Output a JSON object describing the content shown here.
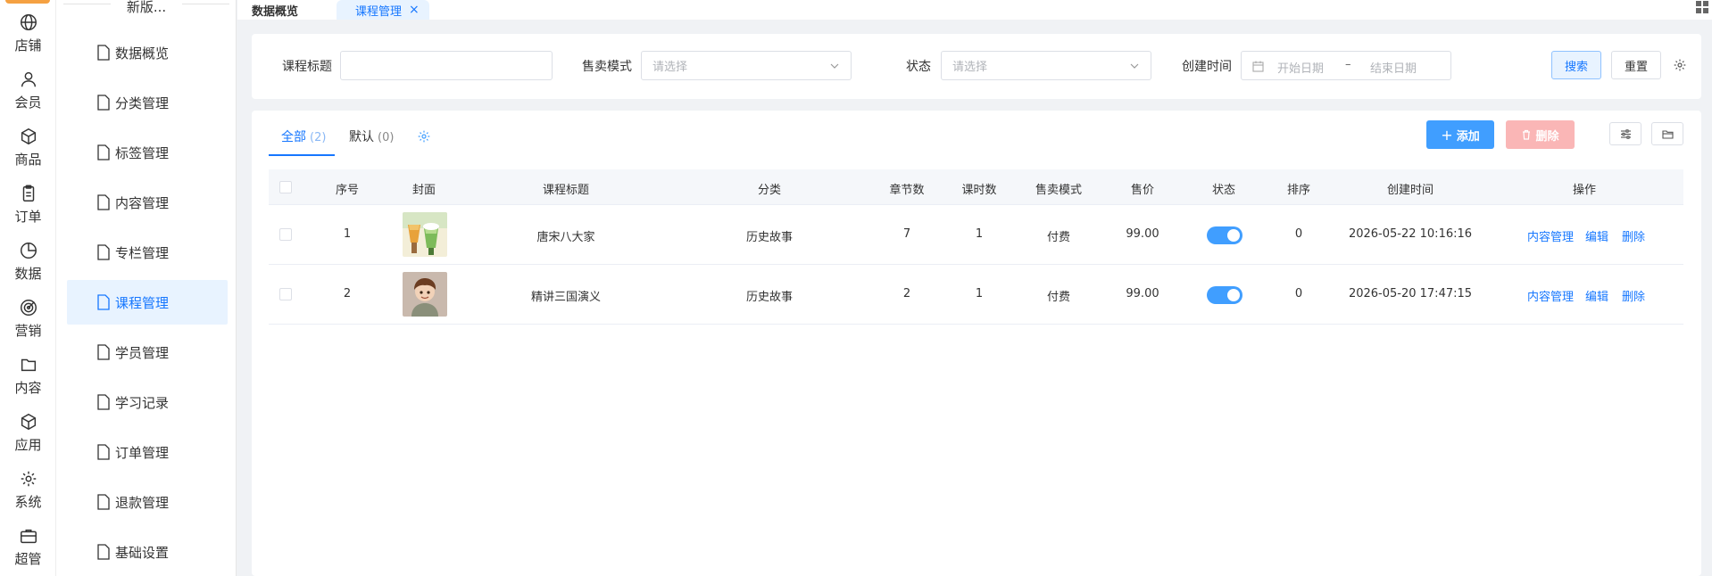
{
  "rail": {
    "items": [
      {
        "label": "店铺",
        "icon": "globe-icon"
      },
      {
        "label": "会员",
        "icon": "user-icon"
      },
      {
        "label": "商品",
        "icon": "box-icon"
      },
      {
        "label": "订单",
        "icon": "clipboard-icon"
      },
      {
        "label": "数据",
        "icon": "pie-chart-icon"
      },
      {
        "label": "营销",
        "icon": "target-icon"
      },
      {
        "label": "内容",
        "icon": "folder-icon"
      },
      {
        "label": "应用",
        "icon": "cube-icon"
      },
      {
        "label": "系统",
        "icon": "gear-icon"
      },
      {
        "label": "超管",
        "icon": "briefcase-icon"
      }
    ]
  },
  "submenu": {
    "title": "新版...",
    "items": [
      {
        "label": "数据概览"
      },
      {
        "label": "分类管理"
      },
      {
        "label": "标签管理"
      },
      {
        "label": "内容管理"
      },
      {
        "label": "专栏管理"
      },
      {
        "label": "课程管理",
        "active": true
      },
      {
        "label": "学员管理"
      },
      {
        "label": "学习记录"
      },
      {
        "label": "订单管理"
      },
      {
        "label": "退款管理"
      },
      {
        "label": "基础设置"
      }
    ]
  },
  "tabs": {
    "items": [
      {
        "label": "数据概览"
      },
      {
        "label": "课程管理",
        "close": "×"
      }
    ]
  },
  "search": {
    "title_label": "课程标题",
    "title_value": "",
    "mode_label": "售卖模式",
    "mode_placeholder": "请选择",
    "status_label": "状态",
    "status_placeholder": "请选择",
    "created_label": "创建时间",
    "start_placeholder": "开始日期",
    "range_sep": "–",
    "end_placeholder": "结束日期",
    "search_btn": "搜索",
    "reset_btn": "重置"
  },
  "list": {
    "tab_all": "全部",
    "tab_all_count": "(2)",
    "tab_default": "默认",
    "tab_default_count": "(0)",
    "add_btn": "添加",
    "delete_btn": "删除",
    "columns": [
      "序号",
      "封面",
      "课程标题",
      "分类",
      "章节数",
      "课时数",
      "售卖模式",
      "售价",
      "状态",
      "排序",
      "创建时间",
      "操作"
    ],
    "rows": [
      {
        "index": "1",
        "title": "唐宋八大家",
        "category": "历史故事",
        "chapters": "7",
        "lessons": "1",
        "mode": "付费",
        "price": "99.00",
        "status": true,
        "sort": "0",
        "created": "2026-05-22 10:16:16",
        "cover": "drinks-cover-image"
      },
      {
        "index": "2",
        "title": "精讲三国演义",
        "category": "历史故事",
        "chapters": "2",
        "lessons": "1",
        "mode": "付费",
        "price": "99.00",
        "status": true,
        "sort": "0",
        "created": "2026-05-20 17:47:15",
        "cover": "boy-cover-image"
      }
    ],
    "actions": {
      "content": "内容管理",
      "edit": "编辑",
      "delete": "删除"
    }
  },
  "colors": {
    "primary": "#1677ff",
    "add_button": "#409eff",
    "delete_button_disabled": "#fab6b6",
    "active_menu_bg": "#e8f3ff",
    "rail_accent": "#f5a142"
  }
}
